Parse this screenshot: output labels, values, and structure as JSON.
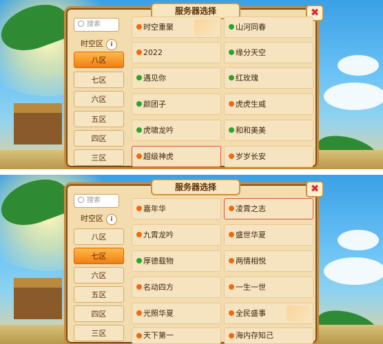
{
  "colors": {
    "status_online": "#2aa52a",
    "status_busy": "#ee6a12",
    "selected_zone": "#f07f12",
    "selected_border": "#e1523c"
  },
  "panel1": {
    "title": "服务器选择",
    "search_placeholder": "搜索",
    "zones": [
      "时空区",
      "八区",
      "七区",
      "六区",
      "五区",
      "四区",
      "三区"
    ],
    "selected_zone": "八区",
    "servers": [
      {
        "name": "时空重聚",
        "status": "orange"
      },
      {
        "name": "山河同春",
        "status": "green"
      },
      {
        "name": "2022",
        "status": "orange"
      },
      {
        "name": "缘分天空",
        "status": "green"
      },
      {
        "name": "遇见你",
        "status": "green"
      },
      {
        "name": "红玫瑰",
        "status": "green"
      },
      {
        "name": "颜团子",
        "status": "green"
      },
      {
        "name": "虎虎生威",
        "status": "orange"
      },
      {
        "name": "虎啸龙吟",
        "status": "green"
      },
      {
        "name": "和和美美",
        "status": "green"
      },
      {
        "name": "超级神虎",
        "status": "orange",
        "selected": true
      },
      {
        "name": "岁岁长安",
        "status": "orange"
      }
    ]
  },
  "panel2": {
    "title": "服务器选择",
    "search_placeholder": "搜索",
    "zones": [
      "时空区",
      "八区",
      "七区",
      "六区",
      "五区",
      "四区",
      "三区"
    ],
    "selected_zone": "七区",
    "servers": [
      {
        "name": "嘉年华",
        "status": "orange"
      },
      {
        "name": "凌霄之志",
        "status": "orange",
        "selected": true
      },
      {
        "name": "九霄龙吟",
        "status": "orange"
      },
      {
        "name": "盛世华夏",
        "status": "orange"
      },
      {
        "name": "厚德载物",
        "status": "green"
      },
      {
        "name": "两情相悦",
        "status": "orange"
      },
      {
        "name": "名动四方",
        "status": "orange"
      },
      {
        "name": "一生一世",
        "status": "orange"
      },
      {
        "name": "光照华夏",
        "status": "orange"
      },
      {
        "name": "全民盛事",
        "status": "orange"
      },
      {
        "name": "天下第一",
        "status": "orange"
      },
      {
        "name": "海内存知己",
        "status": "orange"
      }
    ]
  }
}
